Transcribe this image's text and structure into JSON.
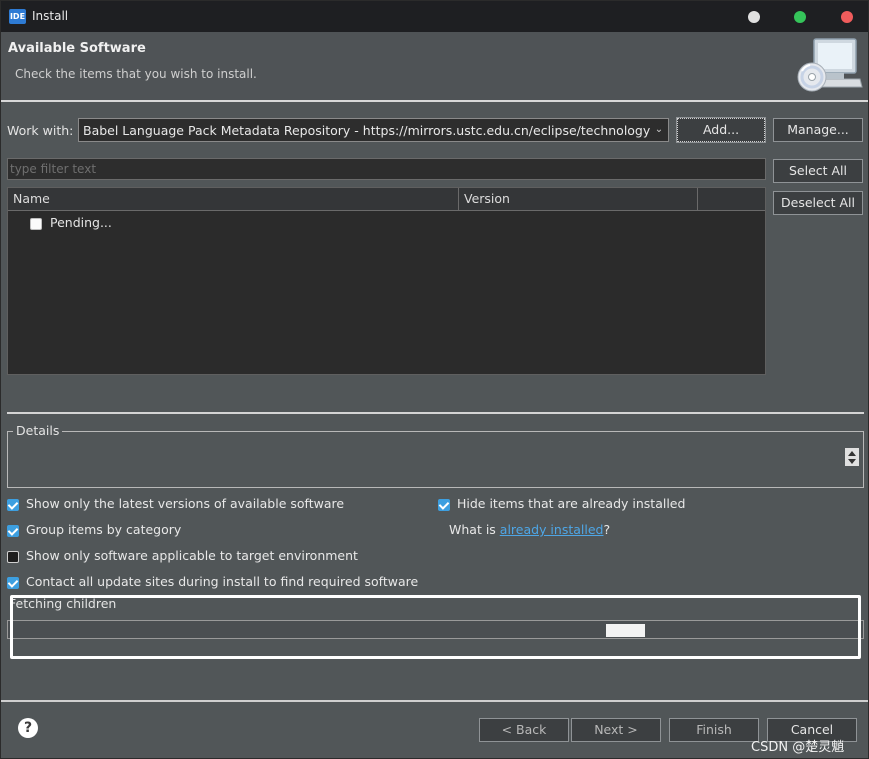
{
  "window": {
    "app_icon": "IDE",
    "title": "Install"
  },
  "banner": {
    "title": "Available Software",
    "subtitle": "Check the items that you wish to install.",
    "icon": "install-disc-icon"
  },
  "work_with": {
    "label": "Work with:",
    "value": "Babel Language Pack Metadata Repository - https://mirrors.ustc.edu.cn/eclipse/technology/babel",
    "add_label": "Add...",
    "manage_label": "Manage..."
  },
  "filter": {
    "placeholder": "type filter text"
  },
  "side_buttons": {
    "select_all": "Select All",
    "deselect_all": "Deselect All"
  },
  "tree": {
    "columns": [
      "Name",
      "Version"
    ],
    "rows": [
      {
        "label": "Pending...",
        "checked": false
      }
    ]
  },
  "details": {
    "label": "Details"
  },
  "options": {
    "latest_versions": "Show only the latest versions of available software",
    "group_by_category": "Group items by category",
    "applicable_only": "Show only software applicable to target environment",
    "contact_sites": "Contact all update sites during install to find required software",
    "hide_installed": "Hide items that are already installed",
    "what_is_prefix": "What is ",
    "what_is_link": "already installed",
    "what_is_suffix": "?"
  },
  "progress": {
    "label": "Fetching children"
  },
  "footer": {
    "back": "< Back",
    "next": "Next >",
    "finish": "Finish",
    "cancel": "Cancel",
    "help": "?"
  },
  "watermark": "CSDN @楚灵魈",
  "colors": {
    "accent": "#3d9fe0",
    "link": "#4ea6e6",
    "background": "#515658",
    "tree_background": "#2b2b2b"
  }
}
